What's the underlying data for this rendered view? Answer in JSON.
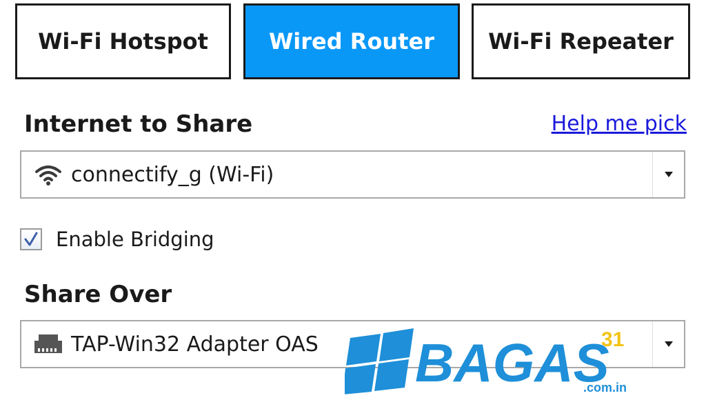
{
  "mode_tabs": [
    {
      "label": "Wi-Fi Hotspot",
      "active": false
    },
    {
      "label": "Wired Router",
      "active": true
    },
    {
      "label": "Wi-Fi Repeater",
      "active": false
    }
  ],
  "internet_section": {
    "title": "Internet to Share",
    "help_link": "Help me pick",
    "selected": "connectify_g (Wi-Fi)",
    "icon": "wifi-icon"
  },
  "bridging": {
    "label": "Enable Bridging",
    "checked": true
  },
  "share_section": {
    "title": "Share Over",
    "selected": "TAP-Win32 Adapter OAS",
    "icon": "network-adapter-icon"
  },
  "watermark": {
    "text": "BAGAS",
    "superscript": "31",
    "domain": ".com.in"
  },
  "colors": {
    "active_tab": "#0a98f7",
    "link": "#1a1adb",
    "watermark": "#1e8fd8"
  }
}
